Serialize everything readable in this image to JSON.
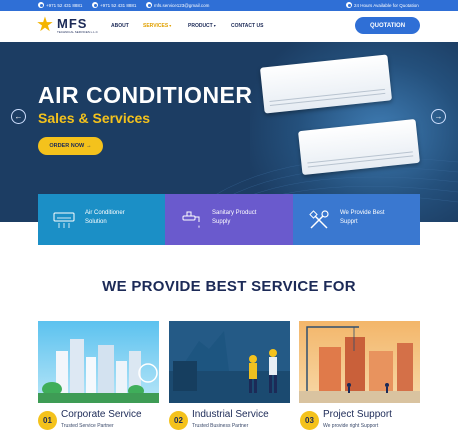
{
  "topbar": {
    "phone_1": "+971 52 431 8881",
    "phone_2": "+971 52 431 8881",
    "email": "mfs.service123@gmail.com",
    "availability": "24 Hours Available for Quotation"
  },
  "header": {
    "logo_text": "MFS",
    "logo_subtext": "TECHNICAL SERVICES L.L.C",
    "nav": [
      {
        "label": "ABOUT",
        "active": false
      },
      {
        "label": "SERVICES",
        "active": true,
        "dropdown": true
      },
      {
        "label": "PRODUCT",
        "active": false,
        "dropdown": true
      },
      {
        "label": "CONTACT US",
        "active": false
      }
    ],
    "quote_button": "QUOTATION"
  },
  "hero": {
    "title": "AIR CONDITIONER",
    "subtitle": "Sales & Services",
    "cta": "ORDER NOW",
    "cta_arrow": "→",
    "prev_icon": "←",
    "next_icon": "→"
  },
  "service_cards": [
    {
      "line1": "Air Conditioner",
      "line2": "Solution",
      "icon": "air-conditioner-icon",
      "color": "#1b8fc6"
    },
    {
      "line1": "Sanitary Product",
      "line2": "Supply",
      "icon": "faucet-icon",
      "color": "#6a5acd"
    },
    {
      "line1": "We Provide Best",
      "line2": "Supprt",
      "icon": "tools-icon",
      "color": "#3a78d0"
    }
  ],
  "section": {
    "title": "WE PROVIDE BEST SERVICE FOR"
  },
  "features": [
    {
      "number": "01",
      "title": "Corporate Service",
      "subtitle": "Trusted Service Partner"
    },
    {
      "number": "02",
      "title": "Industrial Service",
      "subtitle": "Trusted Business Partner"
    },
    {
      "number": "03",
      "title": "Project Support",
      "subtitle": "We provide right Support"
    }
  ],
  "colors": {
    "primary": "#2f6fd6",
    "accent": "#f4c21c",
    "navy": "#1c2a57",
    "hero_bg": "#1c3d63"
  }
}
